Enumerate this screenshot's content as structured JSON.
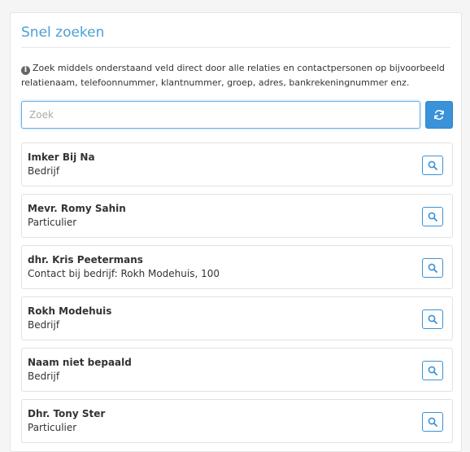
{
  "panel": {
    "title": "Snel zoeken",
    "info_text": "Zoek middels onderstaand veld direct door alle relaties en contactpersonen op bijvoorbeeld relatienaam, telefoonnummer, klantnummer, groep, adres, bankrekeningnummer enz.",
    "info_icon": "info-circle-icon"
  },
  "search": {
    "placeholder": "Zoek",
    "value": "",
    "refresh_icon": "refresh-icon"
  },
  "results": [
    {
      "name": "Imker Bij Na",
      "type": "Bedrijf"
    },
    {
      "name": "Mevr. Romy Sahin",
      "type": "Particulier"
    },
    {
      "name": "dhr. Kris Peetermans",
      "type": "Contact bij bedrijf: Rokh Modehuis, 100"
    },
    {
      "name": "Rokh Modehuis",
      "type": "Bedrijf"
    },
    {
      "name": "Naam niet bepaald",
      "type": "Bedrijf"
    },
    {
      "name": "Dhr. Tony Ster",
      "type": "Particulier"
    }
  ],
  "colors": {
    "accent": "#3a92d8",
    "title": "#4a9fd6"
  }
}
